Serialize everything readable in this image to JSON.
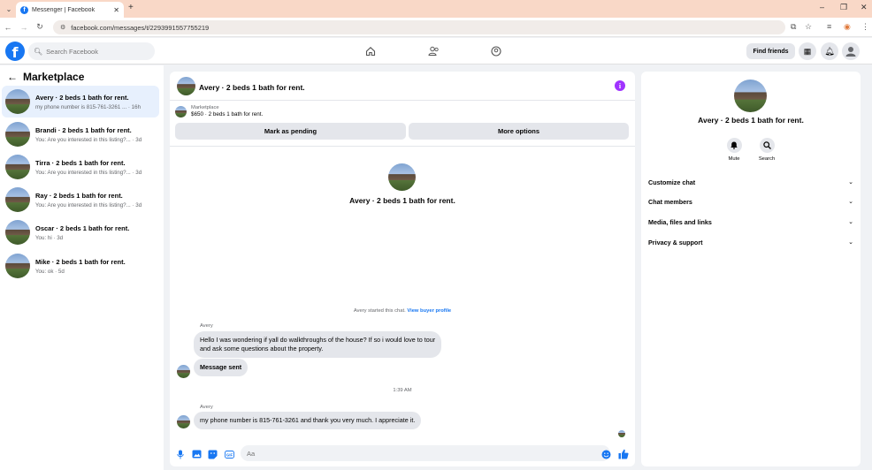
{
  "browser": {
    "tab_title": "Messenger | Facebook",
    "url": "facebook.com/messages/t/2293991557755219"
  },
  "fbnav": {
    "search_placeholder": "Search Facebook",
    "find_friends": "Find friends"
  },
  "sidebar": {
    "title": "Marketplace",
    "conversations": [
      {
        "name": "Avery · 2 beds 1 bath for rent.",
        "preview": "my phone number is 815-761-3261 ... · 16h"
      },
      {
        "name": "Brandi · 2 beds 1 bath for rent.",
        "preview": "You: Are you interested in this listing?... · 3d"
      },
      {
        "name": "Tirra · 2 beds 1 bath for rent.",
        "preview": "You: Are you interested in this listing?... · 3d"
      },
      {
        "name": "Ray · 2 beds 1 bath for rent.",
        "preview": "You: Are you interested in this listing?... · 3d"
      },
      {
        "name": "Oscar · 2 beds 1 bath for rent.",
        "preview": "You: hi · 3d"
      },
      {
        "name": "Mike · 2 beds 1 bath for rent.",
        "preview": "You: ok · 5d"
      }
    ]
  },
  "chat": {
    "title": "Avery · 2 beds 1 bath for rent.",
    "marketplace_label": "Marketplace",
    "listing": "$650 · 2 beds 1 bath for rent.",
    "mark_pending": "Mark as pending",
    "more_options": "More options",
    "center_title": "Avery · 2 beds 1 bath for rent.",
    "started_text": "Avery started this chat.",
    "view_profile": "View buyer profile",
    "messages": [
      {
        "sender": "Avery",
        "lines": [
          "Hello I was wondering if yall do walkthroughs of the house? If so i would love to tour",
          "and ask some questions about the property."
        ]
      },
      {
        "sender": "",
        "lines": [
          "Message sent"
        ]
      },
      {
        "sender": "Avery",
        "lines": [
          "my phone number is 815-761-3261 and thank you very much. I appreciate it."
        ]
      }
    ],
    "timestamp": "1:39 AM",
    "composer_placeholder": "Aa"
  },
  "info": {
    "title": "Avery · 2 beds 1 bath for rent.",
    "mute": "Mute",
    "search": "Search",
    "rows": [
      "Customize chat",
      "Chat members",
      "Media, files and links",
      "Privacy & support"
    ]
  },
  "colors": {
    "brand": "#1877f2",
    "info_purple": "#a033ff",
    "bubble": "#e4e6eb",
    "active_row": "#e7f0fd"
  }
}
